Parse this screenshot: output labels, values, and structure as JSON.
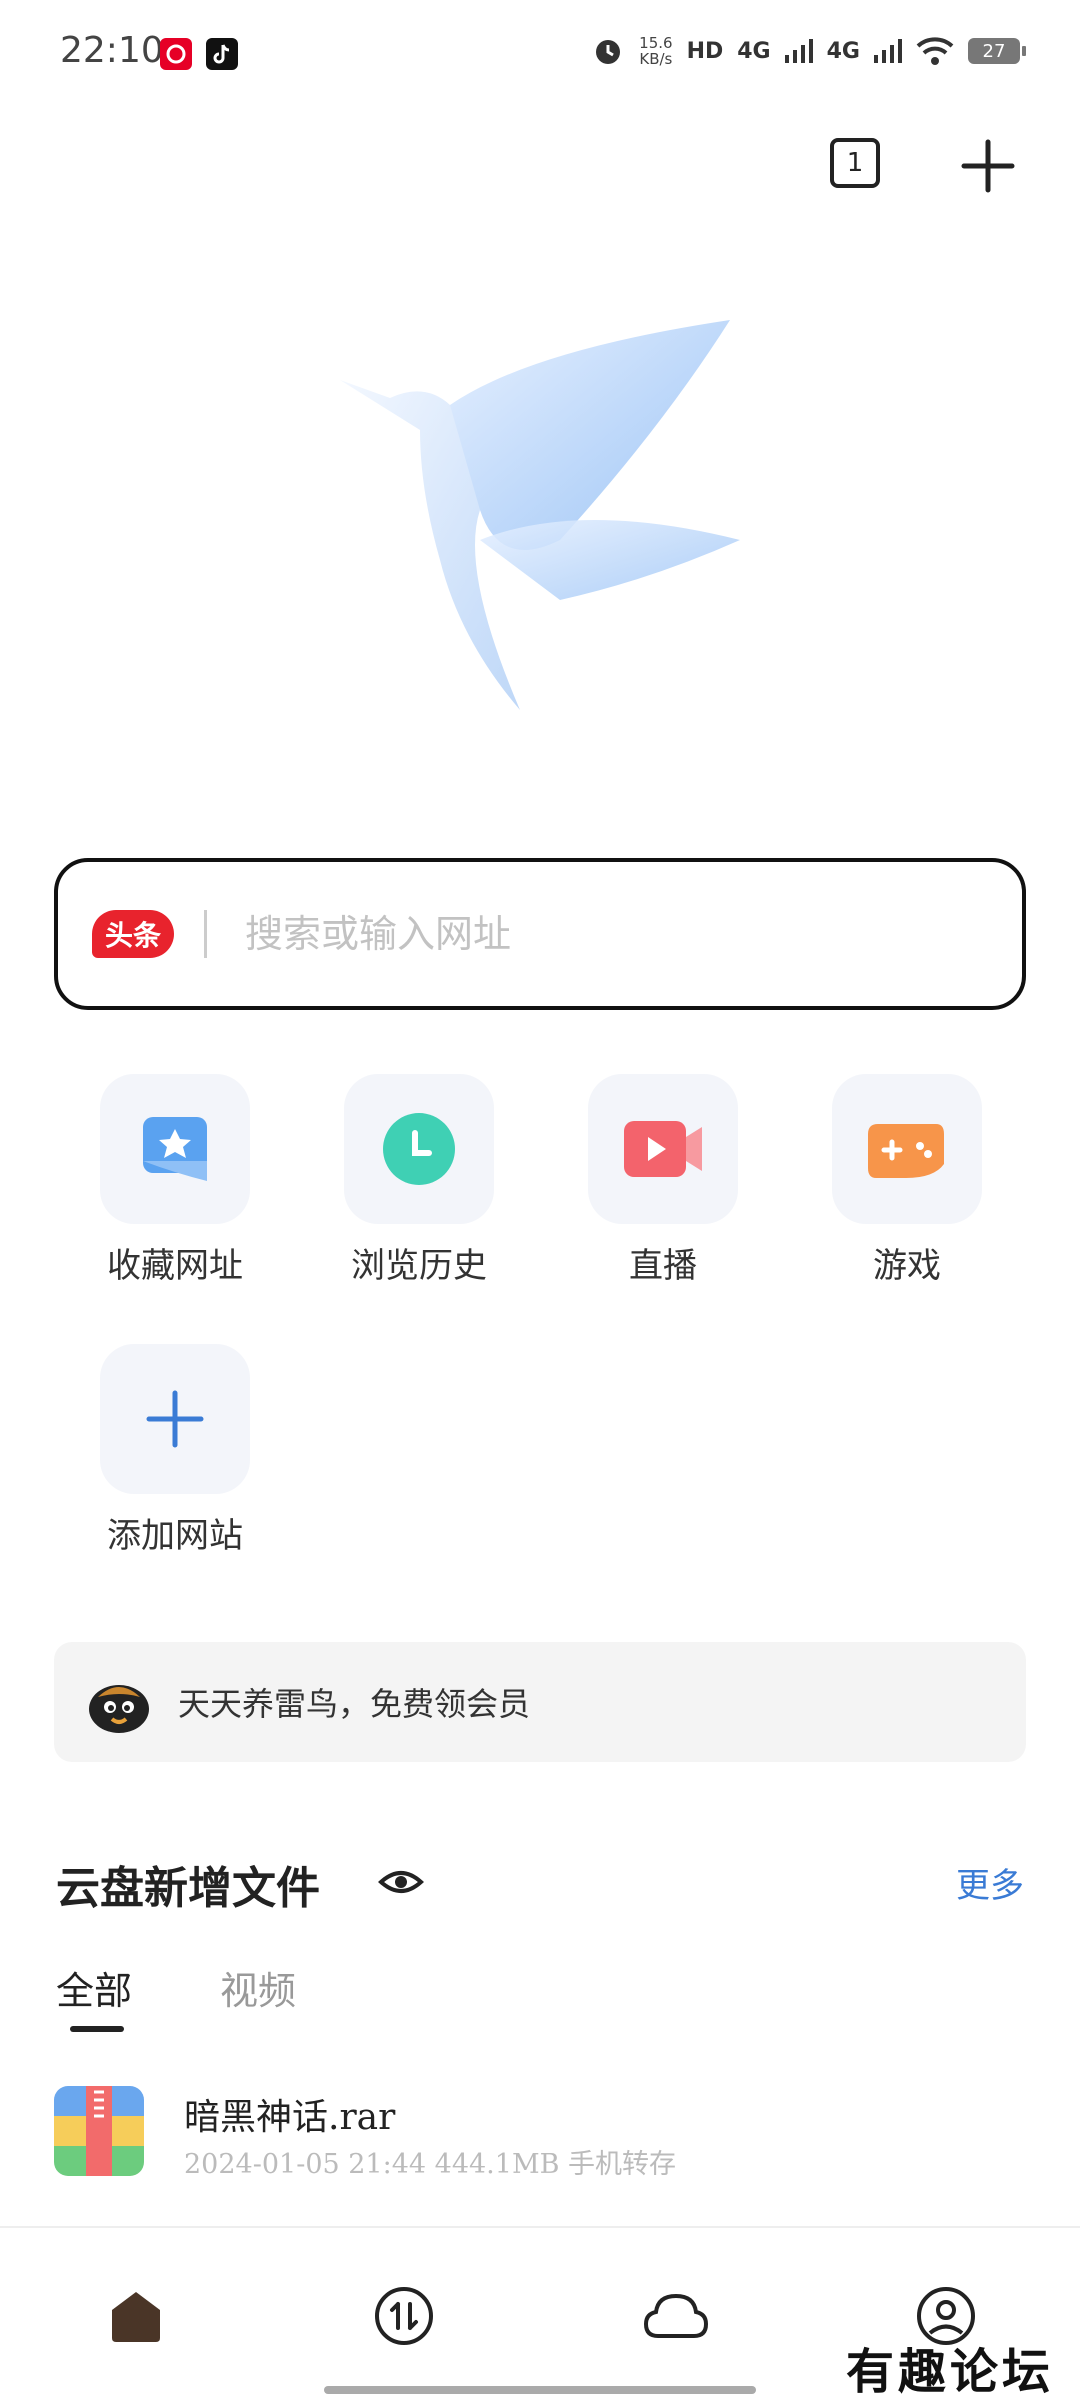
{
  "status_bar": {
    "time": "22:10",
    "speed_value": "15.6",
    "speed_unit": "KB/s",
    "hd_label": "HD",
    "net1": "4G",
    "net2": "4G",
    "battery": "27"
  },
  "top_actions": {
    "tab_count": "1"
  },
  "search": {
    "badge": "头条",
    "placeholder": "搜索或输入网址"
  },
  "quick_access": [
    {
      "label": "收藏网址",
      "icon": "bookmark-star-icon",
      "color": "#5aa2f0"
    },
    {
      "label": "浏览历史",
      "icon": "history-clock-icon",
      "color": "#3fd0b4"
    },
    {
      "label": "直播",
      "icon": "live-video-icon",
      "color": "#f3636c"
    },
    {
      "label": "游戏",
      "icon": "gamepad-icon",
      "color": "#f7954a"
    },
    {
      "label": "添加网站",
      "icon": "plus-icon",
      "color": "#3a7bd5"
    }
  ],
  "promo": {
    "text": "天天养雷鸟，免费领会员"
  },
  "cloud": {
    "title": "云盘新增文件",
    "more": "更多",
    "tabs": [
      "全部",
      "视频"
    ],
    "active_tab": 0,
    "files": [
      {
        "name": "暗黑神话.rar",
        "meta": "2024-01-05 21:44 444.1MB 手机转存"
      }
    ]
  },
  "bottom_nav": [
    "home-icon",
    "transfer-icon",
    "cloud-icon",
    "profile-icon"
  ],
  "watermark": "有趣论坛"
}
